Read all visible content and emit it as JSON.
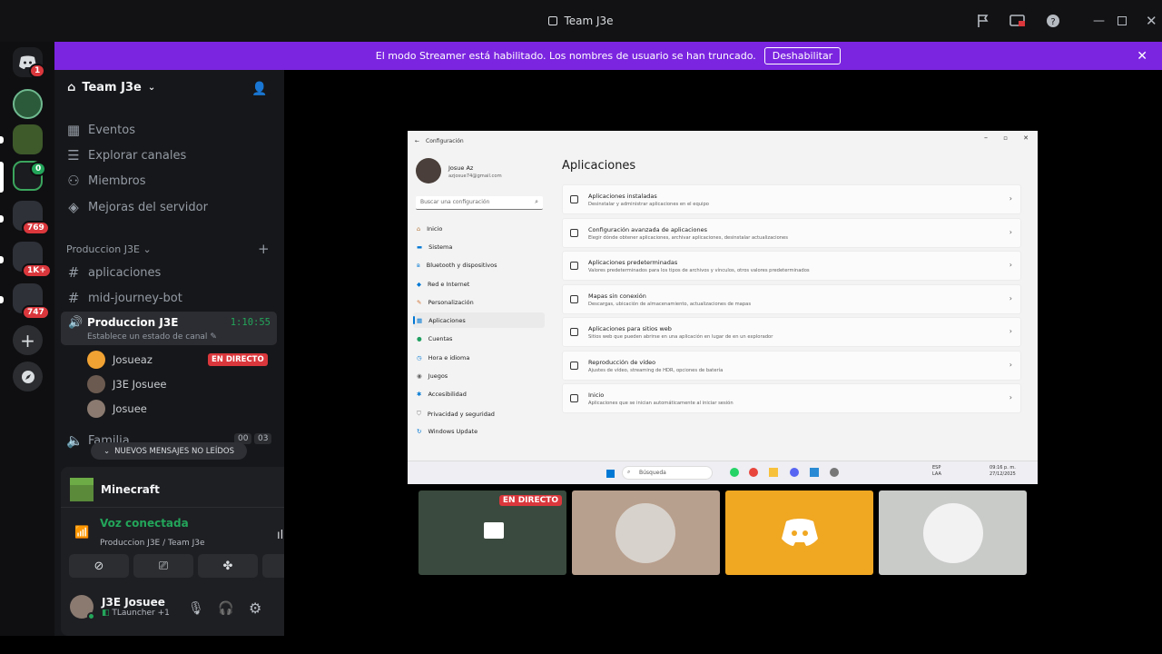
{
  "titlebar": {
    "title": "Team J3e",
    "icons": [
      "flag-icon",
      "screen-icon",
      "help-icon",
      "minimize-icon",
      "maximize-icon",
      "close-icon"
    ]
  },
  "banner": {
    "text": "El modo Streamer está habilitado. Los nombres de usuario se han truncado.",
    "button": "Deshabilitar"
  },
  "guilds": {
    "badge_dm": "1",
    "badge_a": "769",
    "badge_b": "1K+",
    "badge_c": "747"
  },
  "server": {
    "name": "Team J3e"
  },
  "nav": {
    "events": "Eventos",
    "explore": "Explorar canales",
    "members": "Miembros",
    "boosts": "Mejoras del servidor"
  },
  "category": {
    "name": "Produccion J3E"
  },
  "channels": {
    "c1": "aplicaciones",
    "c2": "mid-journey-bot"
  },
  "voice": {
    "name": "Produccion J3E",
    "timer": "1:10:55",
    "status": "Establece un estado de canal",
    "users": [
      {
        "name": "Josueaz",
        "live": "EN DIRECTO"
      },
      {
        "name": "J3E Josuee"
      },
      {
        "name": "Josuee"
      }
    ],
    "next": "Familia",
    "next_counts": [
      "00",
      "03"
    ]
  },
  "new_messages": "NUEVOS MENSAJES NO LEÍDOS",
  "activity": {
    "game": "Minecraft"
  },
  "connection": {
    "status": "Voz conectada",
    "channel": "Produccion J3E / Team J3e"
  },
  "me": {
    "name": "J3E Josuee",
    "sub": "TLauncher +1"
  },
  "settings_window": {
    "title": "Configuración",
    "user_name": "Josue Az",
    "user_email": "azjosue74@gmail.com",
    "search_placeholder": "Buscar una configuración",
    "nav": [
      "Inicio",
      "Sistema",
      "Bluetooth y dispositivos",
      "Red e Internet",
      "Personalización",
      "Aplicaciones",
      "Cuentas",
      "Hora e idioma",
      "Juegos",
      "Accesibilidad",
      "Privacidad y seguridad",
      "Windows Update"
    ],
    "heading": "Aplicaciones",
    "cards": [
      {
        "title": "Aplicaciones instaladas",
        "sub": "Desinstalar y administrar aplicaciones en el equipo"
      },
      {
        "title": "Configuración avanzada de aplicaciones",
        "sub": "Elegir dónde obtener aplicaciones, archivar aplicaciones, desinstalar actualizaciones"
      },
      {
        "title": "Aplicaciones predeterminadas",
        "sub": "Valores predeterminados para los tipos de archivos y vínculos, otros valores predeterminados"
      },
      {
        "title": "Mapas sin conexión",
        "sub": "Descargas, ubicación de almacenamiento, actualizaciones de mapas"
      },
      {
        "title": "Aplicaciones para sitios web",
        "sub": "Sitios web que pueden abrirse en una aplicación en lugar de en un explorador"
      },
      {
        "title": "Reproducción de vídeo",
        "sub": "Ajustes de vídeo, streaming de HDR, opciones de batería"
      },
      {
        "title": "Inicio",
        "sub": "Aplicaciones que se inician automáticamente al iniciar sesión"
      }
    ],
    "taskbar": {
      "search": "Búsqueda",
      "lang": "ESP",
      "lang2": "LAA",
      "time": "09:16 p. m.",
      "date": "27/12/2025"
    }
  },
  "tiles": {
    "live": "EN DIRECTO"
  }
}
